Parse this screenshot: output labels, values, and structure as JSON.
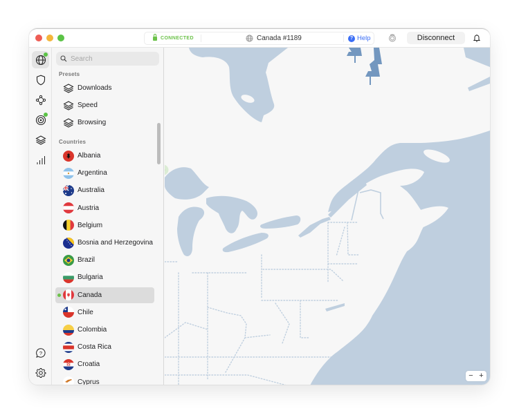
{
  "titlebar": {
    "status": "CONNECTED",
    "server": "Canada #1189",
    "help_label": "Help",
    "disconnect_label": "Disconnect"
  },
  "rail": {
    "items": [
      {
        "icon": "globe-icon",
        "active": true,
        "badge": true
      },
      {
        "icon": "shield-icon",
        "active": false,
        "badge": false
      },
      {
        "icon": "meshnet-icon",
        "active": false,
        "badge": false
      },
      {
        "icon": "target-icon",
        "active": false,
        "badge": true
      },
      {
        "icon": "layers-icon",
        "active": false,
        "badge": false
      },
      {
        "icon": "stats-icon",
        "active": false,
        "badge": false
      }
    ],
    "bottom": [
      {
        "icon": "help-bubble-icon"
      },
      {
        "icon": "settings-gear-icon"
      }
    ]
  },
  "panel": {
    "search_placeholder": "Search",
    "presets_label": "Presets",
    "presets": [
      {
        "label": "Downloads"
      },
      {
        "label": "Speed"
      },
      {
        "label": "Browsing"
      }
    ],
    "countries_label": "Countries",
    "countries": [
      {
        "label": "Albania",
        "flag": "albania"
      },
      {
        "label": "Argentina",
        "flag": "argentina"
      },
      {
        "label": "Australia",
        "flag": "australia"
      },
      {
        "label": "Austria",
        "flag": "austria"
      },
      {
        "label": "Belgium",
        "flag": "belgium"
      },
      {
        "label": "Bosnia and Herzegovina",
        "flag": "bosnia"
      },
      {
        "label": "Brazil",
        "flag": "brazil"
      },
      {
        "label": "Bulgaria",
        "flag": "bulgaria"
      },
      {
        "label": "Canada",
        "flag": "canada",
        "selected": true,
        "connected": true
      },
      {
        "label": "Chile",
        "flag": "chile"
      },
      {
        "label": "Colombia",
        "flag": "colombia"
      },
      {
        "label": "Costa Rica",
        "flag": "costa-rica"
      },
      {
        "label": "Croatia",
        "flag": "croatia"
      },
      {
        "label": "Cyprus",
        "flag": "cyprus"
      }
    ]
  },
  "map": {
    "zoom_out_label": "−",
    "zoom_in_label": "+",
    "colors": {
      "land": "#f7f7f7",
      "water": "#bfcfdf",
      "tree": "#7397bf",
      "server_pin": "#3d5af1",
      "connected_pin": "#6cc24a"
    },
    "pins": [
      {
        "name": "connected-server-pin",
        "status": "connected"
      },
      {
        "name": "server-pin",
        "status": "available"
      },
      {
        "name": "server-pin",
        "status": "available"
      },
      {
        "name": "server-pin",
        "status": "available"
      },
      {
        "name": "server-pin",
        "status": "available"
      },
      {
        "name": "server-pin",
        "status": "available"
      },
      {
        "name": "server-pin",
        "status": "available"
      },
      {
        "name": "server-pin",
        "status": "available"
      }
    ]
  }
}
